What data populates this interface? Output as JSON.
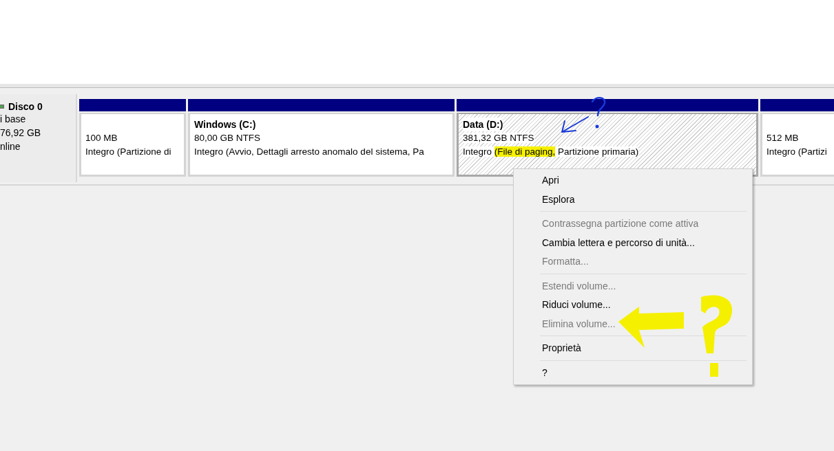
{
  "disk": {
    "name": "Disco 0",
    "lines": [
      "i base",
      "76,92 GB",
      "nline"
    ]
  },
  "partitions": [
    {
      "size": "100 MB",
      "status_parts": [
        {
          "text": "Integro (Partizione di",
          "highlighted": false
        }
      ],
      "selected": false
    },
    {
      "title": "Windows  (C:)",
      "size": "80,00 GB NTFS",
      "status_parts": [
        {
          "text": "Integro (Avvio, Dettagli arresto anomalo del sistema, Pa",
          "highlighted": false
        }
      ],
      "selected": false
    },
    {
      "title": "Data  (D:)",
      "size": "381,32 GB NTFS",
      "status_parts": [
        {
          "text": "Integro ",
          "highlighted": false
        },
        {
          "text": "(File di paging,",
          "highlighted": true
        },
        {
          "text": " Partizione primaria)",
          "highlighted": false
        }
      ],
      "selected": true
    },
    {
      "size": "512 MB",
      "status_parts": [
        {
          "text": "Integro (Partizi",
          "highlighted": false
        }
      ],
      "selected": false
    }
  ],
  "context_menu": [
    {
      "kind": "item",
      "label": "Apri",
      "disabled": false
    },
    {
      "kind": "item",
      "label": "Esplora",
      "disabled": false
    },
    {
      "kind": "separator"
    },
    {
      "kind": "item",
      "label": "Contrassegna partizione come attiva",
      "disabled": true
    },
    {
      "kind": "item",
      "label": "Cambia lettera e percorso di unità...",
      "disabled": false
    },
    {
      "kind": "item",
      "label": "Formatta...",
      "disabled": true
    },
    {
      "kind": "separator"
    },
    {
      "kind": "item",
      "label": "Estendi volume...",
      "disabled": true
    },
    {
      "kind": "item",
      "label": "Riduci volume...",
      "disabled": false
    },
    {
      "kind": "item",
      "label": "Elimina volume...",
      "disabled": true
    },
    {
      "kind": "separator"
    },
    {
      "kind": "item",
      "label": "Proprietà",
      "disabled": false
    },
    {
      "kind": "separator"
    },
    {
      "kind": "item",
      "label": "?",
      "disabled": false
    }
  ]
}
